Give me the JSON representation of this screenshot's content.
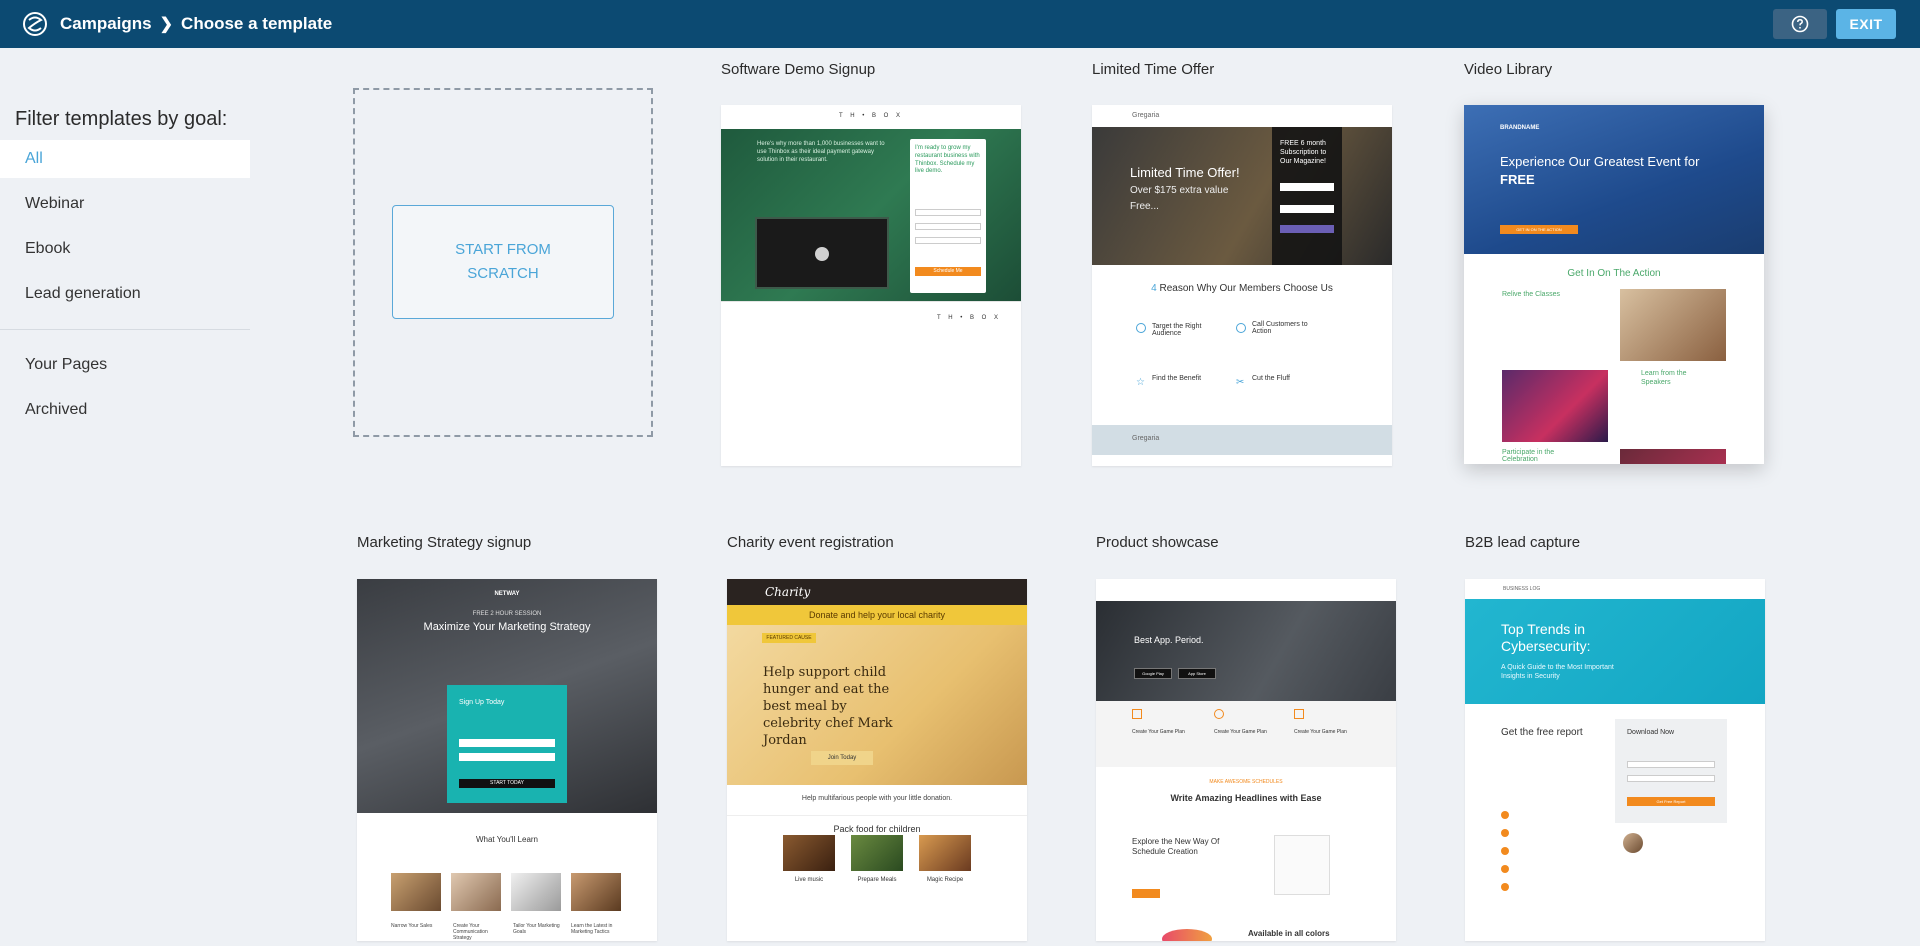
{
  "topbar": {
    "breadcrumb_root": "Campaigns",
    "breadcrumb_separator": ">",
    "breadcrumb_current": "Choose a template",
    "help_icon": "question-circle-icon",
    "exit_label": "EXIT"
  },
  "sidebar": {
    "title": "Filter templates by goal:",
    "items": [
      {
        "label": "All",
        "active": true
      },
      {
        "label": "Webinar"
      },
      {
        "label": "Ebook"
      },
      {
        "label": "Lead generation"
      }
    ],
    "secondary": [
      {
        "label": "Your Pages"
      },
      {
        "label": "Archived"
      }
    ]
  },
  "scratch": {
    "label_line1": "START FROM",
    "label_line2": "SCRATCH"
  },
  "templates": [
    {
      "title": "Software Demo Signup",
      "headline": "Here's why more than 1,000 businesses want to use Thinbox as their ideal payment gateway solution in their restaurant.",
      "form_title": "I'm ready to grow my restaurant business with Thinbox. Schedule my live demo.",
      "button": "Schedule Me"
    },
    {
      "title": "Limited Time Offer",
      "brand": "Gregaria",
      "hero": "Limited Time Offer!",
      "hero_sub": "Over $175 extra value",
      "hero_sub2": "Free...",
      "side_offer": "FREE 6 month Subscription to Our Magazine!",
      "section_num": "4",
      "section_title": "Reason Why Our Members Choose Us",
      "features": [
        "Target the Right Audience",
        "Call Customers to Action",
        "Find the Benefit",
        "Cut the Fluff"
      ]
    },
    {
      "title": "Video Library",
      "brand": "BRANDNAME",
      "hero": "Experience Our Greatest Event for",
      "hero_em": "FREE",
      "cta": "GET IN ON THE ACTION",
      "section": "Get In On The Action",
      "items": [
        "Relive the Classes",
        "Learn from the Speakers",
        "Participate in the Celebration"
      ]
    },
    {
      "title": "Marketing Strategy signup",
      "brand": "NETWAY",
      "kicker": "FREE 2 HOUR SESSION",
      "hero": "Maximize Your Marketing Strategy",
      "form_title": "Sign Up Today",
      "button": "START TODAY",
      "section": "What You'll Learn",
      "captions": [
        "Narrow Your Sales",
        "Create Your Communication Strategy",
        "Tailor Your Marketing Goals",
        "Learn the Latest in Marketing Tactics"
      ]
    },
    {
      "title": "Charity event registration",
      "brand": "Charity",
      "banner": "Donate and help your local charity",
      "badge": "FEATURED CAUSE",
      "hero": "Help support child hunger and eat the best meal by celebrity chef Mark Jordan",
      "button": "Join Today",
      "tagline": "Help multifarious people with your little donation.",
      "section": "Pack food for children",
      "items": [
        "Live music",
        "Prepare Meals",
        "Magic Recipe"
      ]
    },
    {
      "title": "Product showcase",
      "hero": "Best App. Period.",
      "store1": "Google Play",
      "store2": "App Store",
      "features": [
        "Create Your Game Plan",
        "Create Your Game Plan",
        "Create Your Game Plan"
      ],
      "kicker": "MAKE AWESOME SCHEDULES",
      "section": "Write Amazing Headlines with Ease",
      "sub": "Explore the New Way Of Schedule Creation",
      "footer": "Available in all colors"
    },
    {
      "title": "B2B lead capture",
      "brand": "BUSINESS LOG",
      "hero": "Top Trends in Cybersecurity:",
      "hero_sub": "A Quick Guide to the Most Important Insights in Security",
      "report": "Get the free report",
      "form_title": "Download Now",
      "button": "Get Free Report"
    }
  ],
  "colors": {
    "topbar": "#0c4a72",
    "accent": "#4aa5d8",
    "exit": "#5bb4e6",
    "background": "#eef1f5"
  }
}
